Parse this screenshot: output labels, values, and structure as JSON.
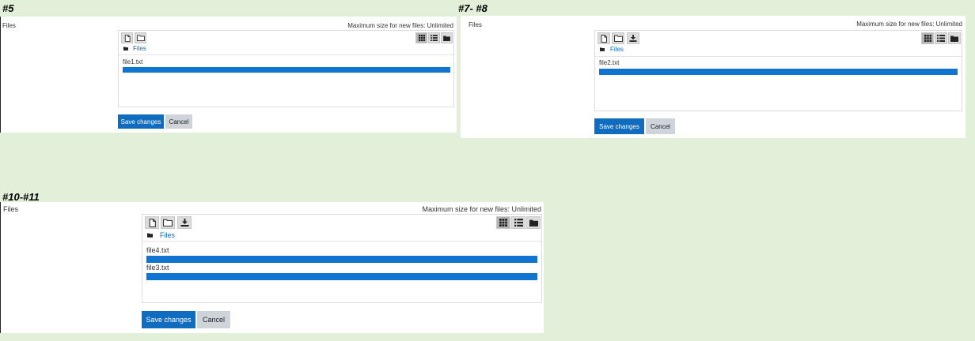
{
  "labels": {
    "step5": "#5",
    "step7_8": "#7- #8",
    "step10_11": "#10-#11"
  },
  "common": {
    "files_label": "Files",
    "max_size": "Maximum size for new files: Unlimited",
    "path_root": "Files",
    "save_label": "Save changes",
    "cancel_label": "Cancel"
  },
  "panel1": {
    "files": [
      {
        "name": "file1.txt",
        "progress": 1.0
      }
    ]
  },
  "panel2": {
    "files": [
      {
        "name": "file2.txt",
        "progress": 1.0
      }
    ]
  },
  "panel3": {
    "files": [
      {
        "name": "file4.txt",
        "progress": 1.0
      },
      {
        "name": "file3.txt",
        "progress": 1.0
      }
    ]
  },
  "icons": {
    "add_file": "file-icon",
    "create_folder": "folder-icon",
    "download": "download-icon",
    "view_icons": "grid-icon",
    "view_list": "list-icon",
    "view_tree": "folder-icon"
  },
  "colors": {
    "background": "#e2efd9",
    "primary": "#0f6cbf",
    "progress": "#0f75d1",
    "secondary": "#ced4da"
  }
}
